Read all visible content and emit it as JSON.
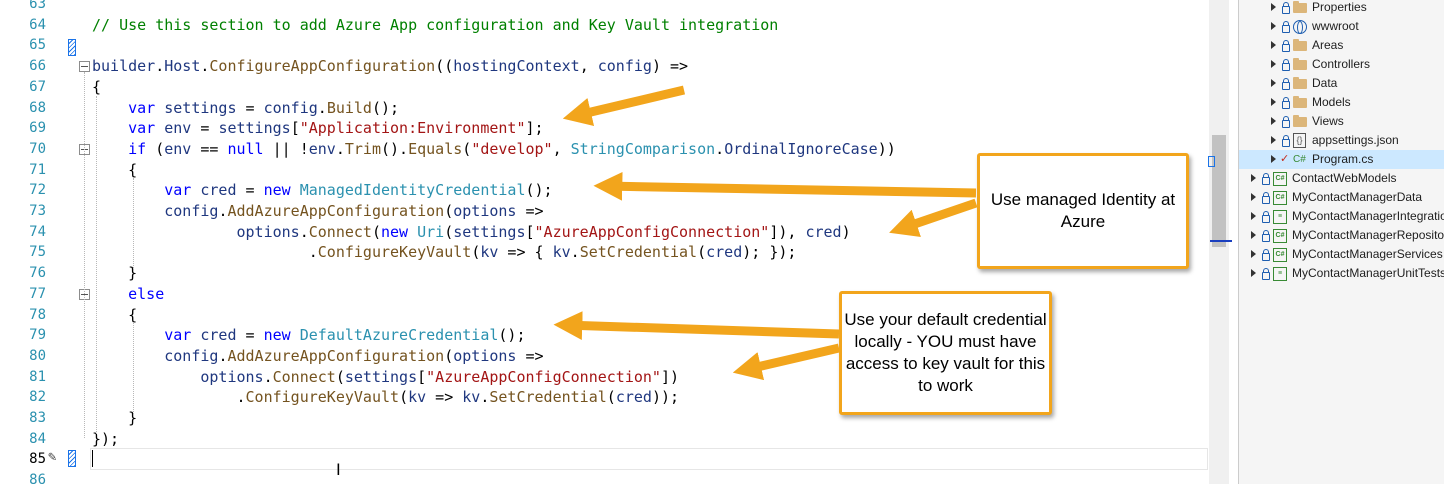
{
  "editor": {
    "line_numbers": [
      "63",
      "64",
      "65",
      "66",
      "67",
      "68",
      "69",
      "70",
      "71",
      "72",
      "73",
      "74",
      "75",
      "76",
      "77",
      "78",
      "79",
      "80",
      "81",
      "82",
      "83",
      "84",
      "85",
      "86"
    ],
    "lines": [
      [],
      [
        {
          "t": "// Use this section to add Azure App configuration and Key Vault integration",
          "c": "cm"
        }
      ],
      [],
      [
        {
          "t": "builder",
          "c": "pa"
        },
        {
          "t": ".",
          "c": ""
        },
        {
          "t": "Host",
          "c": "pa"
        },
        {
          "t": ".",
          "c": ""
        },
        {
          "t": "ConfigureAppConfiguration",
          "c": "me"
        },
        {
          "t": "((",
          "c": ""
        },
        {
          "t": "hostingContext",
          "c": "pa"
        },
        {
          "t": ", ",
          "c": ""
        },
        {
          "t": "config",
          "c": "pa"
        },
        {
          "t": ") =>",
          "c": ""
        }
      ],
      [
        {
          "t": "{",
          "c": ""
        }
      ],
      [
        {
          "t": "    ",
          "c": ""
        },
        {
          "t": "var",
          "c": "kw"
        },
        {
          "t": " ",
          "c": ""
        },
        {
          "t": "settings",
          "c": "pa"
        },
        {
          "t": " = ",
          "c": ""
        },
        {
          "t": "config",
          "c": "pa"
        },
        {
          "t": ".",
          "c": ""
        },
        {
          "t": "Build",
          "c": "me"
        },
        {
          "t": "();",
          "c": ""
        }
      ],
      [
        {
          "t": "    ",
          "c": ""
        },
        {
          "t": "var",
          "c": "kw"
        },
        {
          "t": " ",
          "c": ""
        },
        {
          "t": "env",
          "c": "pa"
        },
        {
          "t": " = ",
          "c": ""
        },
        {
          "t": "settings",
          "c": "pa"
        },
        {
          "t": "[",
          "c": ""
        },
        {
          "t": "\"Application:Environment\"",
          "c": "st"
        },
        {
          "t": "];",
          "c": ""
        }
      ],
      [
        {
          "t": "    ",
          "c": ""
        },
        {
          "t": "if",
          "c": "kw"
        },
        {
          "t": " (",
          "c": ""
        },
        {
          "t": "env",
          "c": "pa"
        },
        {
          "t": " == ",
          "c": ""
        },
        {
          "t": "null",
          "c": "kw"
        },
        {
          "t": " || !",
          "c": ""
        },
        {
          "t": "env",
          "c": "pa"
        },
        {
          "t": ".",
          "c": ""
        },
        {
          "t": "Trim",
          "c": "me"
        },
        {
          "t": "().",
          "c": ""
        },
        {
          "t": "Equals",
          "c": "me"
        },
        {
          "t": "(",
          "c": ""
        },
        {
          "t": "\"develop\"",
          "c": "st"
        },
        {
          "t": ", ",
          "c": ""
        },
        {
          "t": "StringComparison",
          "c": "ty"
        },
        {
          "t": ".",
          "c": ""
        },
        {
          "t": "OrdinalIgnoreCase",
          "c": "pa"
        },
        {
          "t": "))",
          "c": ""
        }
      ],
      [
        {
          "t": "    {",
          "c": ""
        }
      ],
      [
        {
          "t": "        ",
          "c": ""
        },
        {
          "t": "var",
          "c": "kw"
        },
        {
          "t": " ",
          "c": ""
        },
        {
          "t": "cred",
          "c": "pa"
        },
        {
          "t": " = ",
          "c": ""
        },
        {
          "t": "new",
          "c": "kw"
        },
        {
          "t": " ",
          "c": ""
        },
        {
          "t": "ManagedIdentityCredential",
          "c": "ty"
        },
        {
          "t": "();",
          "c": ""
        }
      ],
      [
        {
          "t": "        ",
          "c": ""
        },
        {
          "t": "config",
          "c": "pa"
        },
        {
          "t": ".",
          "c": ""
        },
        {
          "t": "AddAzureAppConfiguration",
          "c": "me"
        },
        {
          "t": "(",
          "c": ""
        },
        {
          "t": "options",
          "c": "pa"
        },
        {
          "t": " =>",
          "c": ""
        }
      ],
      [
        {
          "t": "                ",
          "c": ""
        },
        {
          "t": "options",
          "c": "pa"
        },
        {
          "t": ".",
          "c": ""
        },
        {
          "t": "Connect",
          "c": "me"
        },
        {
          "t": "(",
          "c": ""
        },
        {
          "t": "new",
          "c": "kw"
        },
        {
          "t": " ",
          "c": ""
        },
        {
          "t": "Uri",
          "c": "ty"
        },
        {
          "t": "(",
          "c": ""
        },
        {
          "t": "settings",
          "c": "pa"
        },
        {
          "t": "[",
          "c": ""
        },
        {
          "t": "\"AzureAppConfigConnection\"",
          "c": "st"
        },
        {
          "t": "]), ",
          "c": ""
        },
        {
          "t": "cred",
          "c": "pa"
        },
        {
          "t": ")",
          "c": ""
        }
      ],
      [
        {
          "t": "                        ",
          "c": ""
        },
        {
          "t": ".",
          "c": ""
        },
        {
          "t": "ConfigureKeyVault",
          "c": "me"
        },
        {
          "t": "(",
          "c": ""
        },
        {
          "t": "kv",
          "c": "pa"
        },
        {
          "t": " => { ",
          "c": ""
        },
        {
          "t": "kv",
          "c": "pa"
        },
        {
          "t": ".",
          "c": ""
        },
        {
          "t": "SetCredential",
          "c": "me"
        },
        {
          "t": "(",
          "c": ""
        },
        {
          "t": "cred",
          "c": "pa"
        },
        {
          "t": "); });",
          "c": ""
        }
      ],
      [
        {
          "t": "    }",
          "c": ""
        }
      ],
      [
        {
          "t": "    ",
          "c": ""
        },
        {
          "t": "else",
          "c": "kw"
        }
      ],
      [
        {
          "t": "    {",
          "c": ""
        }
      ],
      [
        {
          "t": "        ",
          "c": ""
        },
        {
          "t": "var",
          "c": "kw"
        },
        {
          "t": " ",
          "c": ""
        },
        {
          "t": "cred",
          "c": "pa"
        },
        {
          "t": " = ",
          "c": ""
        },
        {
          "t": "new",
          "c": "kw"
        },
        {
          "t": " ",
          "c": ""
        },
        {
          "t": "DefaultAzureCredential",
          "c": "ty"
        },
        {
          "t": "();",
          "c": ""
        }
      ],
      [
        {
          "t": "        ",
          "c": ""
        },
        {
          "t": "config",
          "c": "pa"
        },
        {
          "t": ".",
          "c": ""
        },
        {
          "t": "AddAzureAppConfiguration",
          "c": "me"
        },
        {
          "t": "(",
          "c": ""
        },
        {
          "t": "options",
          "c": "pa"
        },
        {
          "t": " =>",
          "c": ""
        }
      ],
      [
        {
          "t": "            ",
          "c": ""
        },
        {
          "t": "options",
          "c": "pa"
        },
        {
          "t": ".",
          "c": ""
        },
        {
          "t": "Connect",
          "c": "me"
        },
        {
          "t": "(",
          "c": ""
        },
        {
          "t": "settings",
          "c": "pa"
        },
        {
          "t": "[",
          "c": ""
        },
        {
          "t": "\"AzureAppConfigConnection\"",
          "c": "st"
        },
        {
          "t": "])",
          "c": ""
        }
      ],
      [
        {
          "t": "                ",
          "c": ""
        },
        {
          "t": ".",
          "c": ""
        },
        {
          "t": "ConfigureKeyVault",
          "c": "me"
        },
        {
          "t": "(",
          "c": ""
        },
        {
          "t": "kv",
          "c": "pa"
        },
        {
          "t": " => ",
          "c": ""
        },
        {
          "t": "kv",
          "c": "pa"
        },
        {
          "t": ".",
          "c": ""
        },
        {
          "t": "SetCredential",
          "c": "me"
        },
        {
          "t": "(",
          "c": ""
        },
        {
          "t": "cred",
          "c": "pa"
        },
        {
          "t": "));",
          "c": ""
        }
      ],
      [
        {
          "t": "    }",
          "c": ""
        }
      ],
      [
        {
          "t": "});",
          "c": ""
        }
      ],
      [],
      []
    ]
  },
  "solution_explorer": {
    "items": [
      {
        "label": "Properties",
        "icon": "folder-icon"
      },
      {
        "label": "wwwroot",
        "icon": "globe-icon"
      },
      {
        "label": "Areas",
        "icon": "folder-icon"
      },
      {
        "label": "Controllers",
        "icon": "folder-icon"
      },
      {
        "label": "Data",
        "icon": "folder-icon"
      },
      {
        "label": "Models",
        "icon": "folder-icon"
      },
      {
        "label": "Views",
        "icon": "folder-icon"
      },
      {
        "label": "appsettings.json",
        "icon": "json-file-icon"
      },
      {
        "label": "Program.cs",
        "icon": "csharp-file-icon",
        "selected": true
      },
      {
        "label": "ContactWebModels",
        "icon": "csharp-project-icon"
      },
      {
        "label": "MyContactManagerData",
        "icon": "csharp-project-icon"
      },
      {
        "label": "MyContactManagerIntegrationTests",
        "icon": "test-project-icon"
      },
      {
        "label": "MyContactManagerRepositories",
        "icon": "csharp-project-icon"
      },
      {
        "label": "MyContactManagerServices",
        "icon": "csharp-project-icon"
      },
      {
        "label": "MyContactManagerUnitTests",
        "icon": "test-project-icon"
      }
    ]
  },
  "callouts": {
    "managed": "Use managed Identity at Azure",
    "default": "Use your default credential locally - YOU must have access to key vault for this to work"
  },
  "colors": {
    "callout_border": "#f2a51c",
    "arrow": "#f2a51c",
    "line_number": "#2b91af",
    "keyword": "#0000ff",
    "type": "#2b91af",
    "string": "#a31515",
    "comment": "#008000",
    "selection": "#cce8ff"
  }
}
